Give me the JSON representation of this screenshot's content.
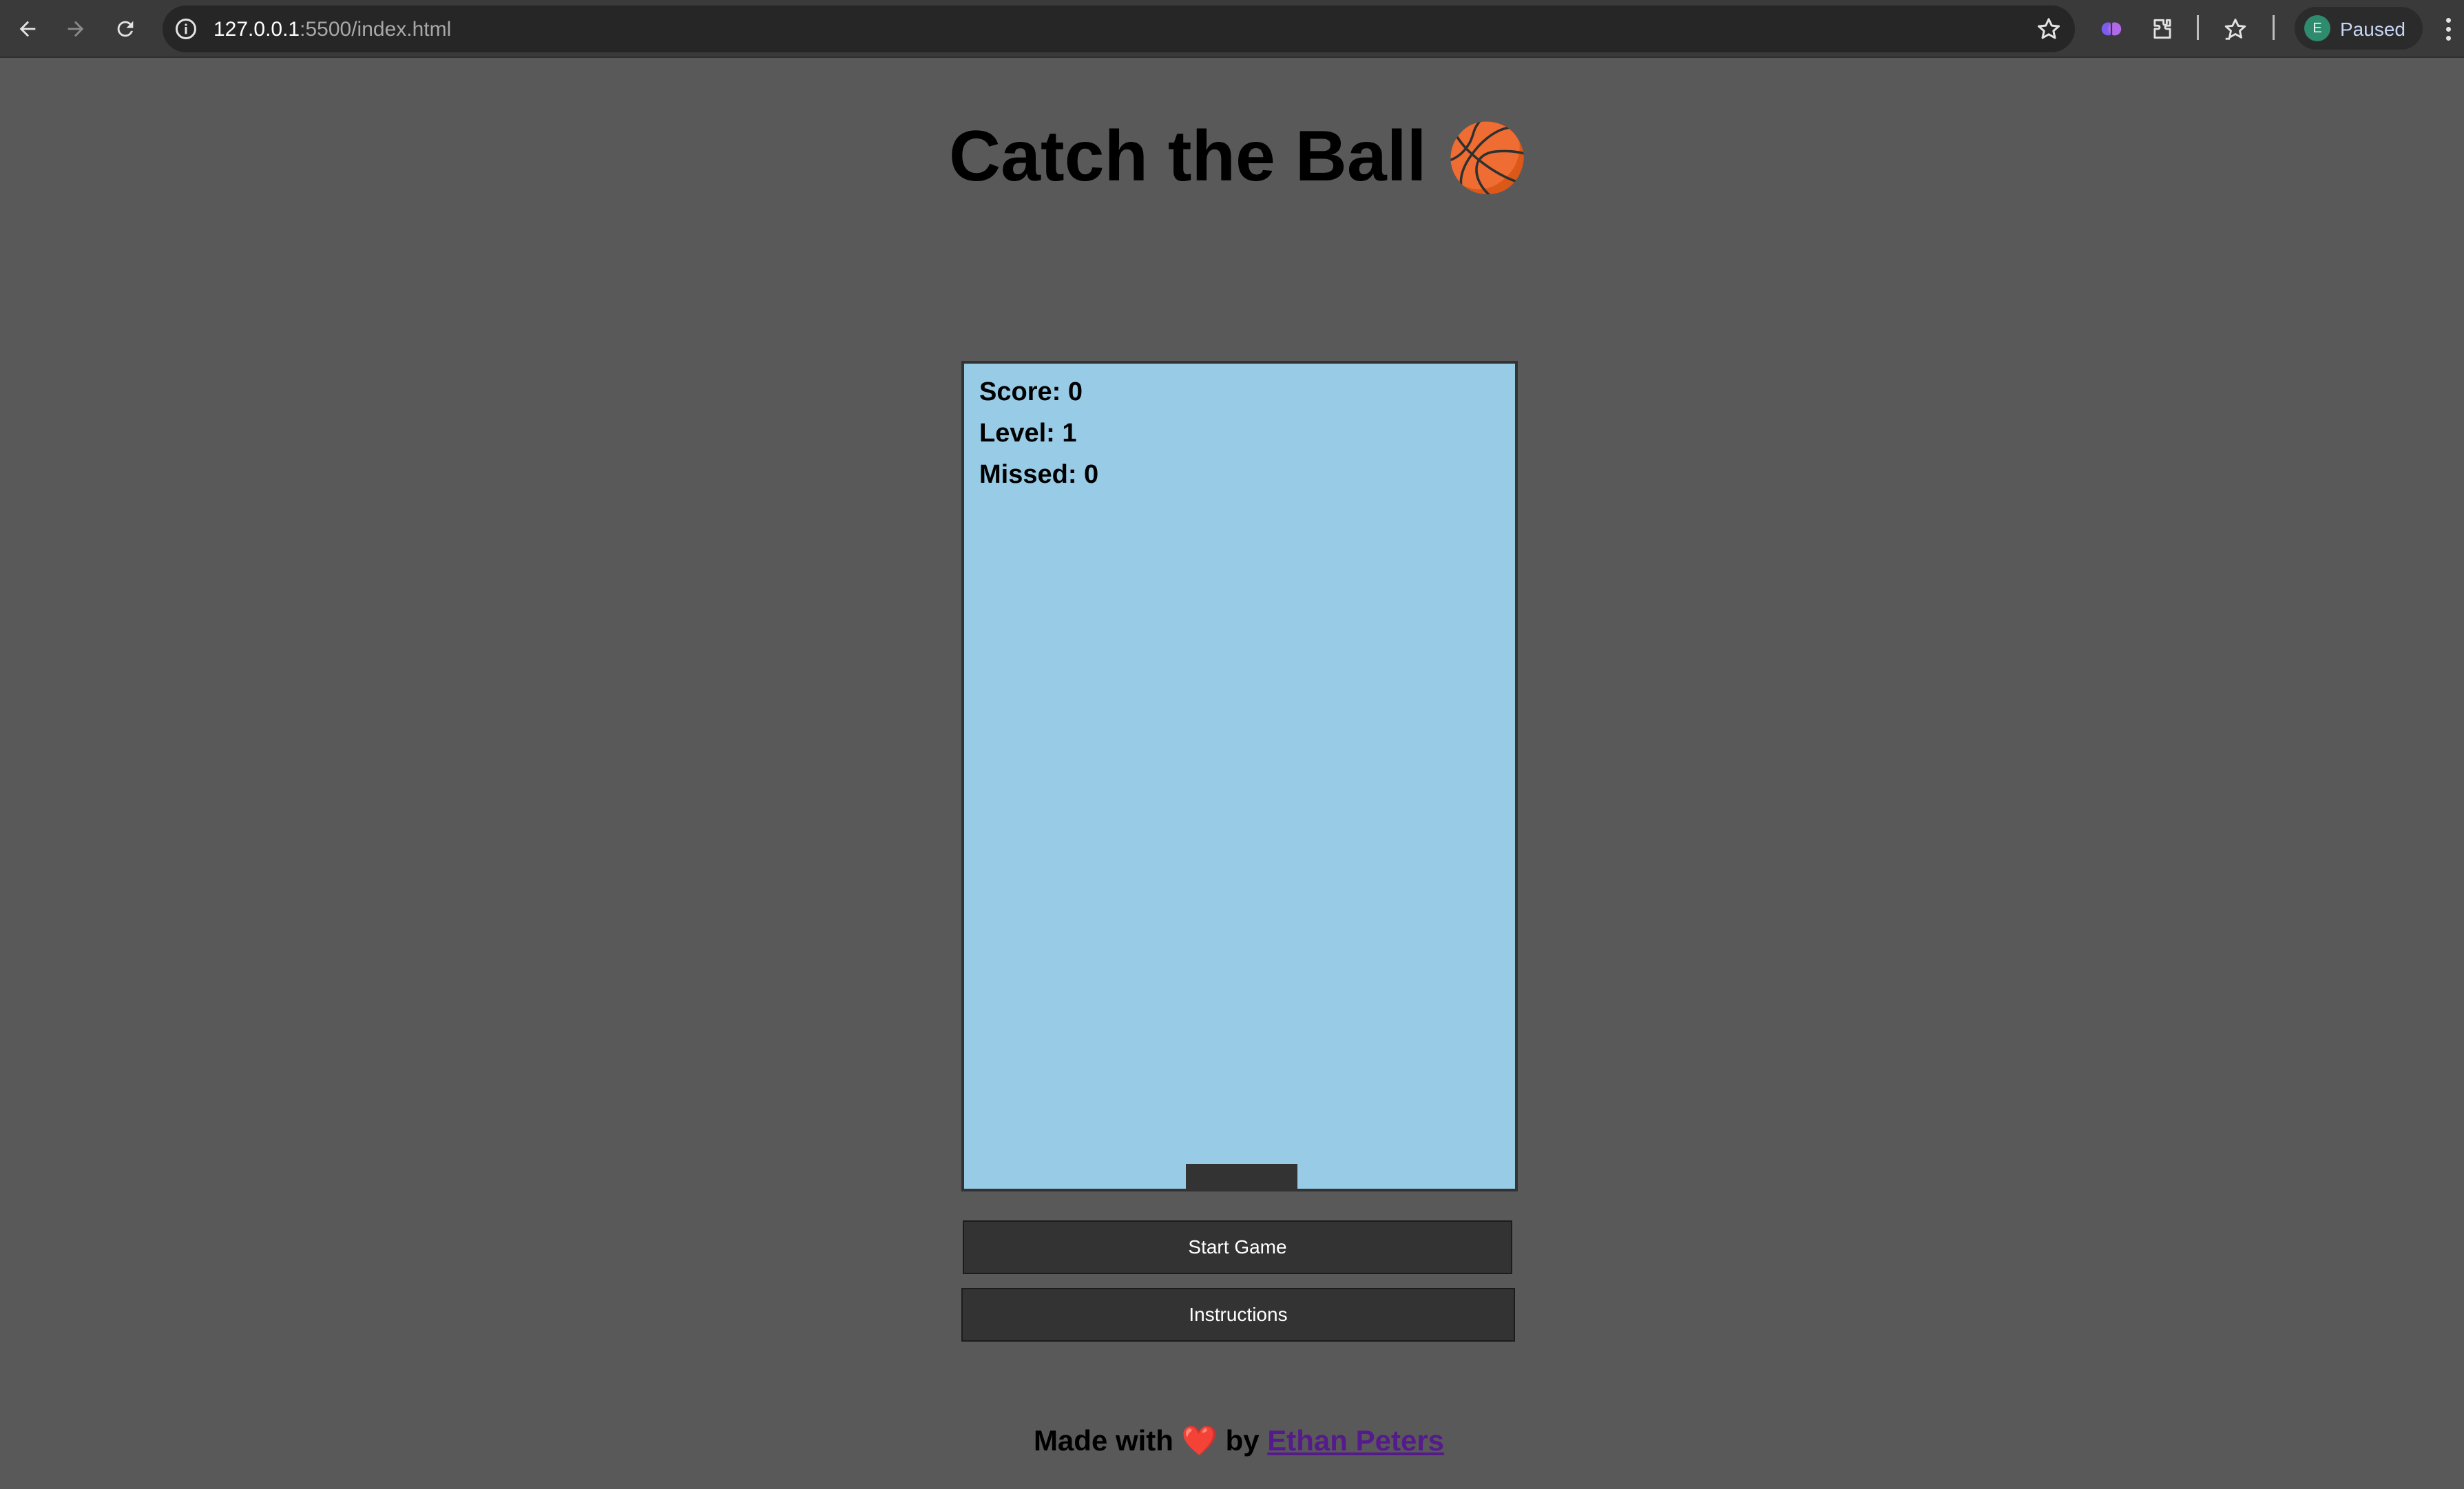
{
  "browser": {
    "url_host": "127.0.0.1",
    "url_path": ":5500/index.html",
    "profile_initial": "E",
    "profile_status": "Paused",
    "icons": [
      "back-icon",
      "forward-icon",
      "reload-icon",
      "info-icon",
      "bookmark-star-icon",
      "extension-brain-icon",
      "extensions-puzzle-icon",
      "bookmarks-icon",
      "menu-dots-icon"
    ]
  },
  "page": {
    "title": "Catch the Ball",
    "title_emoji": "🏀"
  },
  "game": {
    "score_label": "Score: 0",
    "level_label": "Level: 1",
    "missed_label": "Missed: 0",
    "background_color": "#97cbe6"
  },
  "buttons": {
    "start_label": "Start Game",
    "instructions_label": "Instructions"
  },
  "footer": {
    "prefix": "Made with",
    "heart": "❤️",
    "by": "by",
    "author": "Ethan Peters"
  }
}
